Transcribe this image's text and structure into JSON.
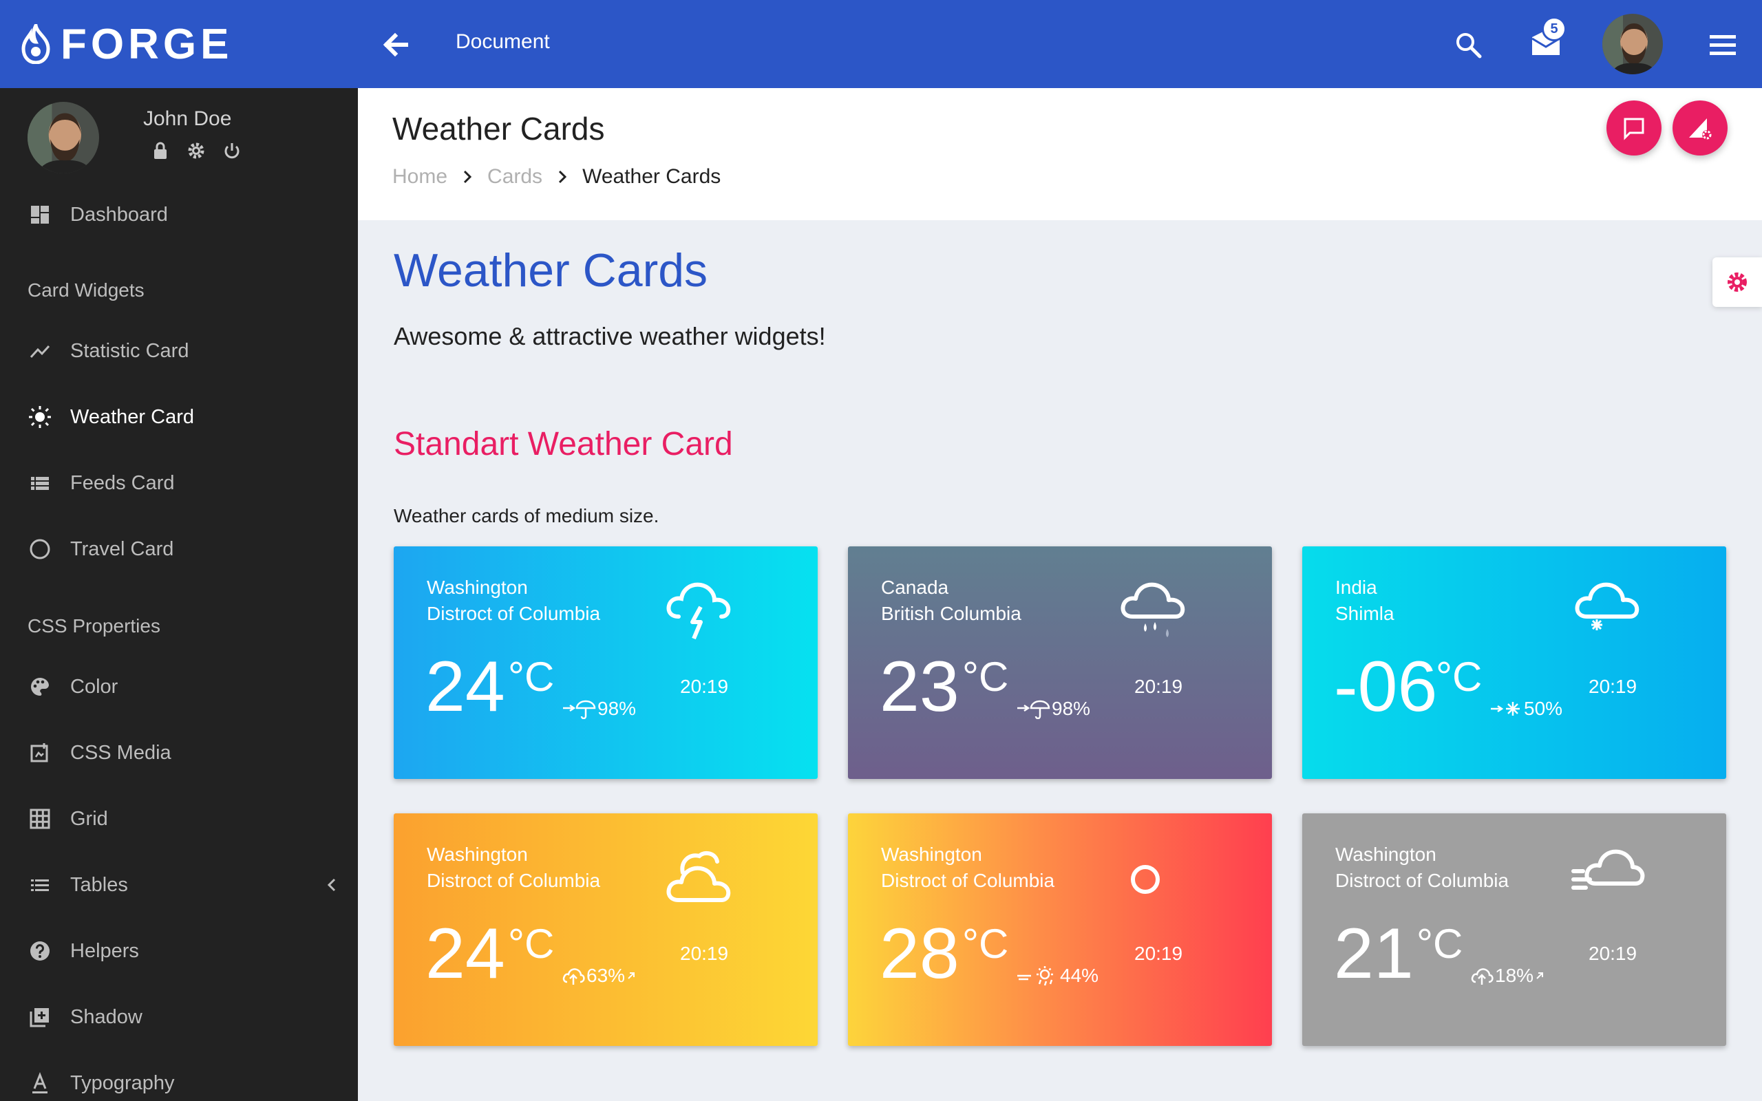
{
  "app": {
    "brand": "FORGE",
    "document_title": "Document",
    "mail_count": "5"
  },
  "user": {
    "name": "John Doe"
  },
  "sidebar": {
    "items": [
      {
        "label": "Dashboard",
        "icon": "dashboard-icon"
      },
      {
        "header": "Card Widgets"
      },
      {
        "label": "Statistic Card",
        "icon": "trending-icon"
      },
      {
        "label": "Weather Card",
        "icon": "sun-icon",
        "active": true
      },
      {
        "label": "Feeds Card",
        "icon": "list-icon"
      },
      {
        "label": "Travel Card",
        "icon": "circle-icon"
      },
      {
        "header": "CSS Properties"
      },
      {
        "label": "Color",
        "icon": "palette-icon"
      },
      {
        "label": "CSS Media",
        "icon": "media-icon"
      },
      {
        "label": "Grid",
        "icon": "grid-icon"
      },
      {
        "label": "Tables",
        "icon": "table-icon"
      },
      {
        "label": "Helpers",
        "icon": "help-icon"
      },
      {
        "label": "Shadow",
        "icon": "shadow-icon"
      },
      {
        "label": "Typography",
        "icon": "typography-icon"
      }
    ]
  },
  "header": {
    "title": "Weather Cards",
    "breadcrumb": [
      "Home",
      "Cards",
      "Weather Cards"
    ]
  },
  "main": {
    "title": "Weather Cards",
    "subtitle": "Awesome & attractive weather widgets!",
    "section_title": "Standart Weather Card",
    "section_desc": "Weather cards of medium size."
  },
  "cards": [
    {
      "line1": "Washington",
      "line2": "Distroct of Columbia",
      "temp": "24",
      "unit": "°C",
      "metric": "98%",
      "metric_icon": "rain-umbrella-icon",
      "time": "20:19",
      "weather_icon": "thunder-cloud-icon"
    },
    {
      "line1": "Canada",
      "line2": "British Columbia",
      "temp": "23",
      "unit": "°C",
      "metric": "98%",
      "metric_icon": "rain-umbrella-icon",
      "time": "20:19",
      "weather_icon": "rain-cloud-icon"
    },
    {
      "line1": "India",
      "line2": "Shimla",
      "temp": "-06",
      "unit": "°C",
      "metric": "50%",
      "metric_icon": "snow-wind-icon",
      "time": "20:19",
      "weather_icon": "snow-cloud-icon"
    },
    {
      "line1": "Washington",
      "line2": "Distroct of Columbia",
      "temp": "24",
      "unit": "°C",
      "metric": "63%",
      "metric_icon": "cloud-up-icon",
      "time": "20:19",
      "weather_icon": "cloudy-icon"
    },
    {
      "line1": "Washington",
      "line2": "Distroct of Columbia",
      "temp": "28",
      "unit": "°C",
      "metric": "44%",
      "metric_icon": "sun-wind-icon",
      "time": "20:19",
      "weather_icon": "sun-circle-icon"
    },
    {
      "line1": "Washington",
      "line2": "Distroct of Columbia",
      "temp": "21",
      "unit": "°C",
      "metric": "18%",
      "metric_icon": "cloud-up-icon",
      "time": "20:19",
      "weather_icon": "fog-cloud-icon"
    }
  ]
}
